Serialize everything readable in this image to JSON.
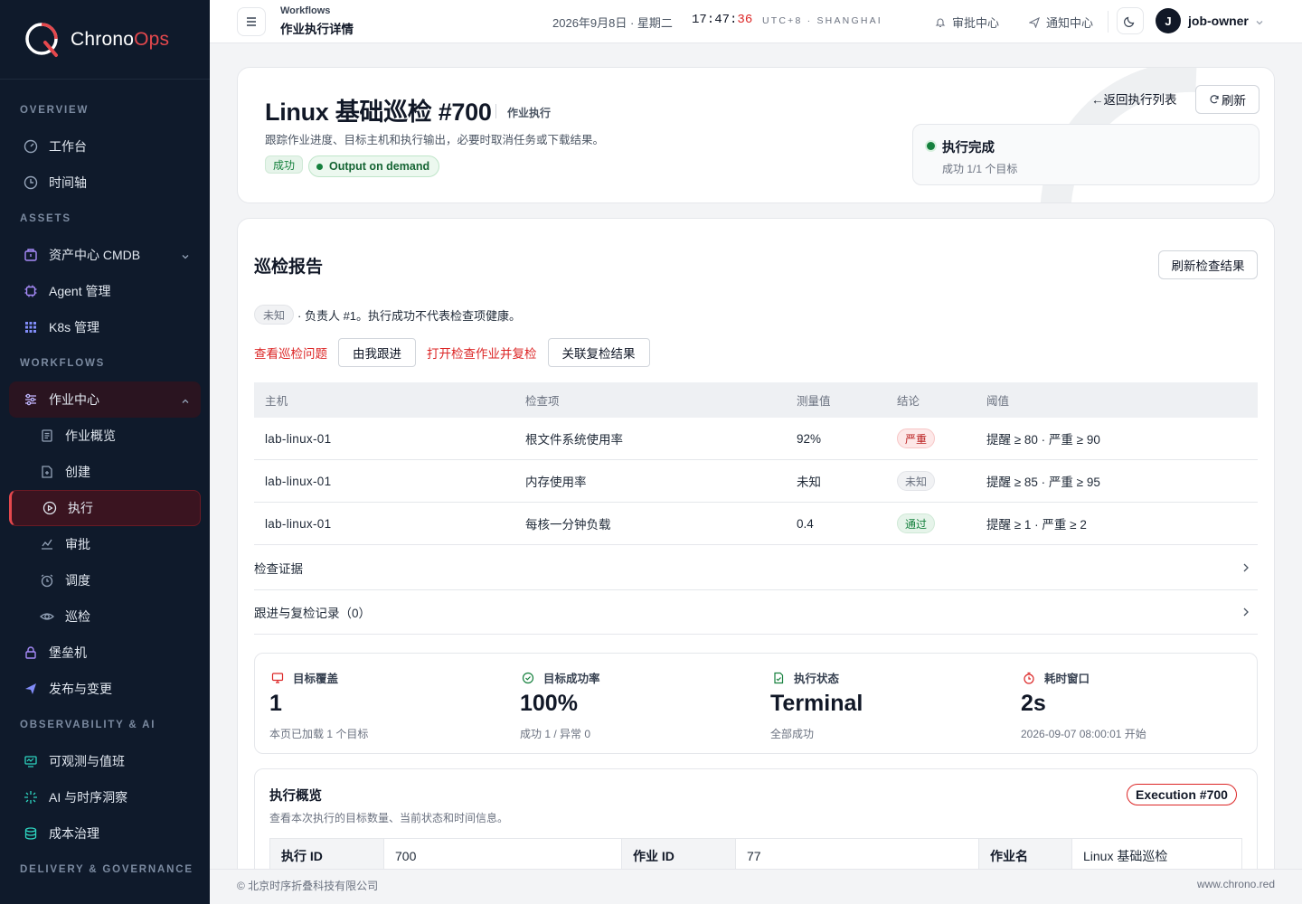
{
  "brand": {
    "name_a": "Chrono",
    "name_b": "Ops",
    "accent": "#e5484d"
  },
  "sidebar": {
    "sections": [
      "OVERVIEW",
      "ASSETS",
      "WORKFLOWS",
      "OBSERVABILITY & AI",
      "DELIVERY & GOVERNANCE"
    ],
    "overview": [
      {
        "label": "工作台",
        "icon": "dashboard-icon"
      },
      {
        "label": "时间轴",
        "icon": "clock-icon"
      }
    ],
    "assets": [
      {
        "label": "资产中心 CMDB",
        "icon": "box-icon"
      },
      {
        "label": "Agent 管理",
        "icon": "chip-icon"
      },
      {
        "label": "K8s 管理",
        "icon": "grid-icon"
      }
    ],
    "workflows_group": {
      "label": "作业中心",
      "icon": "sliders-icon"
    },
    "workflows_sub": [
      {
        "label": "作业概览",
        "icon": "doc-icon"
      },
      {
        "label": "创建",
        "icon": "doc-plus-icon"
      },
      {
        "label": "执行",
        "icon": "play-icon"
      },
      {
        "label": "审批",
        "icon": "approve-icon"
      },
      {
        "label": "调度",
        "icon": "alarm-icon"
      },
      {
        "label": "巡检",
        "icon": "eye-icon"
      }
    ],
    "workflows_more": [
      {
        "label": "堡垒机",
        "icon": "lock-icon"
      },
      {
        "label": "发布与变更",
        "icon": "send-icon"
      }
    ],
    "observability": [
      {
        "label": "可观测与值班",
        "icon": "monitor-icon"
      },
      {
        "label": "AI 与时序洞察",
        "icon": "sparkle-icon"
      },
      {
        "label": "成本治理",
        "icon": "db-icon"
      }
    ]
  },
  "topbar": {
    "crumb_section": "Workflows",
    "crumb_page": "作业执行详情",
    "date": "2026年9月8日 · 星期二",
    "time_hm": "17:47:",
    "time_s": "36",
    "timezone": "UTC+8 · SHANGHAI",
    "approval_center": "审批中心",
    "notify_center": "通知中心",
    "avatar_initial": "J",
    "user": "job-owner"
  },
  "header": {
    "title": "Linux 基础巡检 #700",
    "kind": "作业执行",
    "description": "跟踪作业进度、目标主机和执行输出，必要时取消任务或下载结果。",
    "badge_status": "成功",
    "badge_mode": "Output on demand",
    "back_label": "返回执行列表",
    "refresh_label": "刷新",
    "status_title": "执行完成",
    "status_sub": "成功 1/1 个目标"
  },
  "report": {
    "title": "巡检报告",
    "refresh_button": "刷新检查结果",
    "owner_status": "未知",
    "owner_text": "· 负责人 #1。执行成功不代表检查项健康。",
    "action_view_issues": "查看巡检问题",
    "action_follow": "由我跟进",
    "action_recheck": "打开检查作业并复检",
    "action_link_result": "关联复检结果",
    "columns": [
      "主机",
      "检查项",
      "测量值",
      "结论",
      "阈值"
    ],
    "rows": [
      {
        "host": "lab-linux-01",
        "item": "根文件系统使用率",
        "value": "92%",
        "result": "严重",
        "threshold": "提醒 ≥ 80 · 严重 ≥ 90"
      },
      {
        "host": "lab-linux-01",
        "item": "内存使用率",
        "value": "未知",
        "result": "未知",
        "threshold": "提醒 ≥ 85 · 严重 ≥ 95"
      },
      {
        "host": "lab-linux-01",
        "item": "每核一分钟负载",
        "value": "0.4",
        "result": "通过",
        "threshold": "提醒 ≥ 1 · 严重 ≥ 2"
      }
    ],
    "evidence": "检查证据",
    "followups": "跟进与复检记录（0）"
  },
  "stats": [
    {
      "label": "目标覆盖",
      "value": "1",
      "sub": "本页已加载 1 个目标",
      "icon": "monitor-icon",
      "color": "#dc2626"
    },
    {
      "label": "目标成功率",
      "value": "100%",
      "sub": "成功 1 / 异常 0",
      "icon": "check-circle-icon",
      "color": "#15803d"
    },
    {
      "label": "执行状态",
      "value": "Terminal",
      "sub": "全部成功",
      "icon": "file-check-icon",
      "color": "#15803d"
    },
    {
      "label": "耗时窗口",
      "value": "2s",
      "sub": "2026-09-07 08:00:01 开始",
      "icon": "timer-icon",
      "color": "#dc2626"
    }
  ],
  "overview": {
    "title": "执行概览",
    "description": "查看本次执行的目标数量、当前状态和时间信息。",
    "badge": "Execution #700",
    "k1": "执行 ID",
    "v1": "700",
    "k2": "作业 ID",
    "v2": "77",
    "k3": "作业名",
    "v3": "Linux 基础巡检"
  },
  "footer": {
    "copyright": "© 北京时序折叠科技有限公司",
    "site": "www.chrono.red"
  }
}
